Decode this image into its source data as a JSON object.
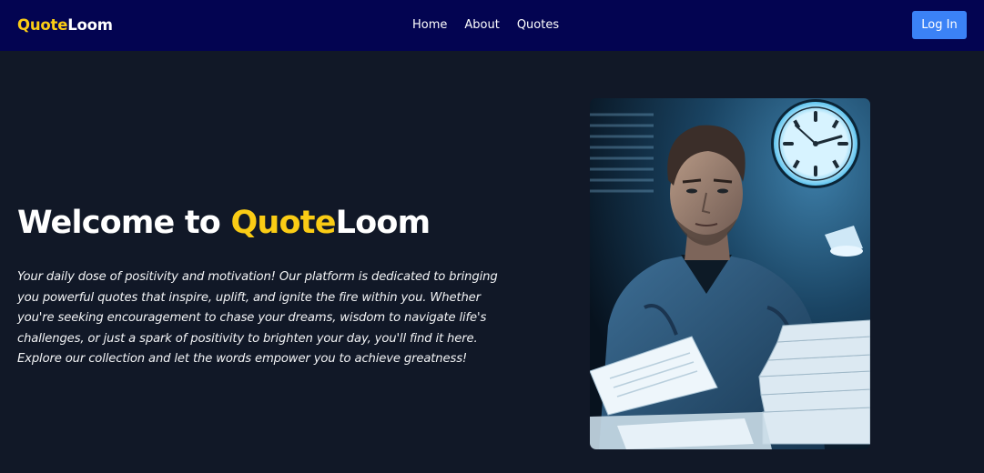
{
  "brand": {
    "accent": "Quote",
    "rest": "Loom",
    "accent_color": "#facc15"
  },
  "nav": {
    "links": [
      "Home",
      "About",
      "Quotes"
    ],
    "login_label": "Log In",
    "background": "#030451",
    "button_color": "#3b82f6"
  },
  "hero": {
    "title_prefix": "Welcome to ",
    "title_accent": "Quote",
    "title_rest": "Loom",
    "description": "Your daily dose of positivity and motivation! Our platform is dedicated to bringing you powerful quotes that inspire, uplift, and ignite the fire within you. Whether you're seeking encouragement to chase your dreams, wisdom to navigate life's challenges, or just a spark of positivity to brighten your day, you'll find it here. Explore our collection and let the words empower you to achieve greatness!",
    "image_subject": "man-reading-papers-with-clock"
  },
  "page_background": "#111827"
}
